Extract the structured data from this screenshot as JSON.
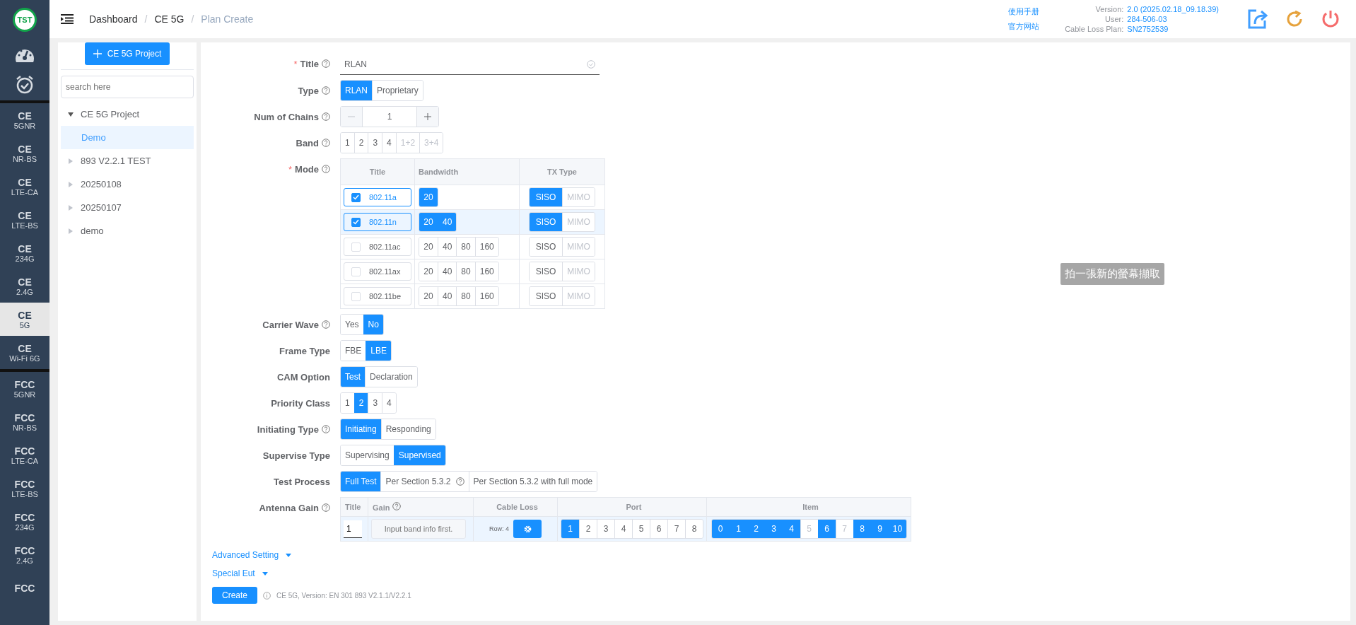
{
  "logo": "TST",
  "nav": {
    "groups": [
      [
        {
          "title": "CE",
          "sub": "5GNR",
          "selected": false
        },
        {
          "title": "CE",
          "sub": "NR-BS",
          "selected": false
        },
        {
          "title": "CE",
          "sub": "LTE-CA",
          "selected": false
        },
        {
          "title": "CE",
          "sub": "LTE-BS",
          "selected": false
        },
        {
          "title": "CE",
          "sub": "234G",
          "selected": false
        },
        {
          "title": "CE",
          "sub": "2.4G",
          "selected": false
        },
        {
          "title": "CE",
          "sub": "5G",
          "selected": true
        },
        {
          "title": "CE",
          "sub": "Wi-Fi 6G",
          "selected": false
        }
      ],
      [
        {
          "title": "FCC",
          "sub": "5GNR",
          "selected": false
        },
        {
          "title": "FCC",
          "sub": "NR-BS",
          "selected": false
        },
        {
          "title": "FCC",
          "sub": "LTE-CA",
          "selected": false
        },
        {
          "title": "FCC",
          "sub": "LTE-BS",
          "selected": false
        },
        {
          "title": "FCC",
          "sub": "234G",
          "selected": false
        },
        {
          "title": "FCC",
          "sub": "2.4G",
          "selected": false
        },
        {
          "title": "FCC",
          "selected": false
        }
      ]
    ]
  },
  "breadcrumbs": [
    {
      "label": "Dashboard",
      "current": false
    },
    {
      "separator": "/",
      "label": "CE 5G",
      "current": false
    },
    {
      "separator": "/",
      "label": "Plan Create",
      "current": true
    }
  ],
  "help_links": [
    "使用手册",
    "官方网站"
  ],
  "info": [
    {
      "label": "Version:",
      "value": "2.0 (2025.02.18_09.18.39)"
    },
    {
      "label": "User:",
      "value": "284-506-03"
    },
    {
      "label": "Cable Loss Plan:",
      "value": "SN2752539"
    }
  ],
  "tree": {
    "add_button": "CE 5G Project",
    "search": {
      "placeholder": "search here"
    },
    "nodes": [
      {
        "label": "CE 5G Project",
        "expanded": true,
        "selected": false,
        "children": [
          {
            "label": "Demo",
            "selected": true
          }
        ]
      },
      {
        "label": "893 V2.2.1 TEST",
        "expanded": false,
        "selected": false
      },
      {
        "label": "20250108",
        "expanded": false,
        "selected": false
      },
      {
        "label": "20250107",
        "expanded": false,
        "selected": false
      },
      {
        "label": "demo",
        "expanded": false,
        "selected": false
      }
    ]
  },
  "form": [
    {
      "kind": "input",
      "label": "Title",
      "required_mark": "*",
      "help": true,
      "value": "RLAN"
    },
    {
      "kind": "segmented",
      "label": "Type",
      "help": true,
      "options": [
        {
          "label": "RLAN",
          "selected": true,
          "disabled": false
        },
        {
          "label": "Proprietary",
          "selected": false,
          "disabled": false
        }
      ]
    },
    {
      "kind": "stepper",
      "label": "Num of Chains",
      "help": true,
      "value": "1"
    },
    {
      "kind": "segmented",
      "label": "Band",
      "help": true,
      "options": [
        {
          "label": "1",
          "selected": false,
          "disabled": false
        },
        {
          "label": "2",
          "selected": false,
          "disabled": false
        },
        {
          "label": "3",
          "selected": false,
          "disabled": false
        },
        {
          "label": "4",
          "selected": false,
          "disabled": false
        },
        {
          "label": "1+2",
          "selected": false,
          "disabled": true
        },
        {
          "label": "3+4",
          "selected": false,
          "disabled": true
        }
      ]
    },
    {
      "kind": "mode_table",
      "label": "Mode",
      "required_mark": "*",
      "help": true,
      "columns": [
        "Title",
        "Bandwidth",
        "TX Type"
      ],
      "rows": [
        {
          "title": "802.11a",
          "checked": true,
          "highlighted": false,
          "bandwidths": [
            {
              "label": "20",
              "selected": true
            }
          ],
          "tx": [
            {
              "label": "SISO",
              "selected": true,
              "disabled": false
            },
            {
              "label": "MIMO",
              "selected": false,
              "disabled": true
            }
          ]
        },
        {
          "title": "802.11n",
          "checked": true,
          "highlighted": true,
          "bandwidths": [
            {
              "label": "20",
              "selected": true
            },
            {
              "label": "40",
              "selected": true
            }
          ],
          "tx": [
            {
              "label": "SISO",
              "selected": true,
              "disabled": false
            },
            {
              "label": "MIMO",
              "selected": false,
              "disabled": true
            }
          ]
        },
        {
          "title": "802.11ac",
          "checked": false,
          "highlighted": false,
          "bandwidths": [
            {
              "label": "20",
              "selected": false
            },
            {
              "label": "40",
              "selected": false
            },
            {
              "label": "80",
              "selected": false
            },
            {
              "label": "160",
              "selected": false
            }
          ],
          "tx": [
            {
              "label": "SISO",
              "selected": false,
              "disabled": false
            },
            {
              "label": "MIMO",
              "selected": false,
              "disabled": true
            }
          ]
        },
        {
          "title": "802.11ax",
          "checked": false,
          "highlighted": false,
          "bandwidths": [
            {
              "label": "20",
              "selected": false
            },
            {
              "label": "40",
              "selected": false
            },
            {
              "label": "80",
              "selected": false
            },
            {
              "label": "160",
              "selected": false
            }
          ],
          "tx": [
            {
              "label": "SISO",
              "selected": false,
              "disabled": false
            },
            {
              "label": "MIMO",
              "selected": false,
              "disabled": true
            }
          ]
        },
        {
          "title": "802.11be",
          "checked": false,
          "highlighted": false,
          "bandwidths": [
            {
              "label": "20",
              "selected": false
            },
            {
              "label": "40",
              "selected": false
            },
            {
              "label": "80",
              "selected": false
            },
            {
              "label": "160",
              "selected": false
            }
          ],
          "tx": [
            {
              "label": "SISO",
              "selected": false,
              "disabled": false
            },
            {
              "label": "MIMO",
              "selected": false,
              "disabled": true
            }
          ]
        }
      ]
    },
    {
      "kind": "segmented",
      "label": "Carrier Wave",
      "help": true,
      "options": [
        {
          "label": "Yes",
          "selected": false,
          "disabled": false
        },
        {
          "label": "No",
          "selected": true,
          "disabled": false
        }
      ]
    },
    {
      "kind": "segmented",
      "label": "Frame Type",
      "help": false,
      "options": [
        {
          "label": "FBE",
          "selected": false,
          "disabled": false
        },
        {
          "label": "LBE",
          "selected": true,
          "disabled": false
        }
      ]
    },
    {
      "kind": "segmented",
      "label": "CAM Option",
      "help": false,
      "options": [
        {
          "label": "Test",
          "selected": true,
          "disabled": false
        },
        {
          "label": "Declaration",
          "selected": false,
          "disabled": false
        }
      ]
    },
    {
      "kind": "segmented",
      "label": "Priority Class",
      "help": false,
      "options": [
        {
          "label": "1",
          "selected": false,
          "disabled": false
        },
        {
          "label": "2",
          "selected": true,
          "disabled": false
        },
        {
          "label": "3",
          "selected": false,
          "disabled": false
        },
        {
          "label": "4",
          "selected": false,
          "disabled": false
        }
      ]
    },
    {
      "kind": "segmented",
      "label": "Initiating Type",
      "help": true,
      "options": [
        {
          "label": "Initiating",
          "selected": true,
          "disabled": false
        },
        {
          "label": "Responding",
          "selected": false,
          "disabled": false
        }
      ]
    },
    {
      "kind": "segmented",
      "label": "Supervise Type",
      "help": false,
      "options": [
        {
          "label": "Supervising",
          "selected": false,
          "disabled": false
        },
        {
          "label": "Supervised",
          "selected": true,
          "disabled": false
        }
      ]
    },
    {
      "kind": "segmented",
      "label": "Test Process",
      "help": false,
      "options": [
        {
          "label": "Full Test",
          "selected": true,
          "disabled": false
        },
        {
          "label": "Per Section 5.3.2",
          "selected": false,
          "disabled": false,
          "help": true
        },
        {
          "label": "Per Section 5.3.2 with full mode",
          "selected": false,
          "disabled": false
        }
      ]
    },
    {
      "kind": "gain_table",
      "label": "Antenna Gain",
      "help": true,
      "columns": [
        {
          "label": "Title",
          "help": false
        },
        {
          "label": "Gain",
          "help": true
        },
        {
          "label": "Cable Loss",
          "help": false
        },
        {
          "label": "Port",
          "help": false
        },
        {
          "label": "Item",
          "help": false
        }
      ],
      "row": {
        "title": "1",
        "gain_placeholder": "Input band info first.",
        "cable_loss": "Row: 4",
        "ports": [
          {
            "label": "1",
            "selected": true
          },
          {
            "label": "2",
            "selected": false
          },
          {
            "label": "3",
            "selected": false
          },
          {
            "label": "4",
            "selected": false
          },
          {
            "label": "5",
            "selected": false
          },
          {
            "label": "6",
            "selected": false
          },
          {
            "label": "7",
            "selected": false
          },
          {
            "label": "8",
            "selected": false
          }
        ],
        "items": [
          {
            "label": "0",
            "selected": true,
            "disabled": false
          },
          {
            "label": "1",
            "selected": true,
            "disabled": false
          },
          {
            "label": "2",
            "selected": true,
            "disabled": false
          },
          {
            "label": "3",
            "selected": true,
            "disabled": false
          },
          {
            "label": "4",
            "selected": true,
            "disabled": false
          },
          {
            "label": "5",
            "selected": false,
            "disabled": true
          },
          {
            "label": "6",
            "selected": true,
            "disabled": false
          },
          {
            "label": "7",
            "selected": false,
            "disabled": true
          },
          {
            "label": "8",
            "selected": true,
            "disabled": false
          },
          {
            "label": "9",
            "selected": true,
            "disabled": false
          },
          {
            "label": "10",
            "selected": true,
            "disabled": false
          }
        ]
      }
    }
  ],
  "collapsibles": [
    "Advanced Setting",
    "Special Eut"
  ],
  "create_button": "Create",
  "version_note": "CE 5G, Version: EN 301 893 V2.1.1/V2.2.1",
  "tooltip": "拍一張新的螢幕擷取"
}
